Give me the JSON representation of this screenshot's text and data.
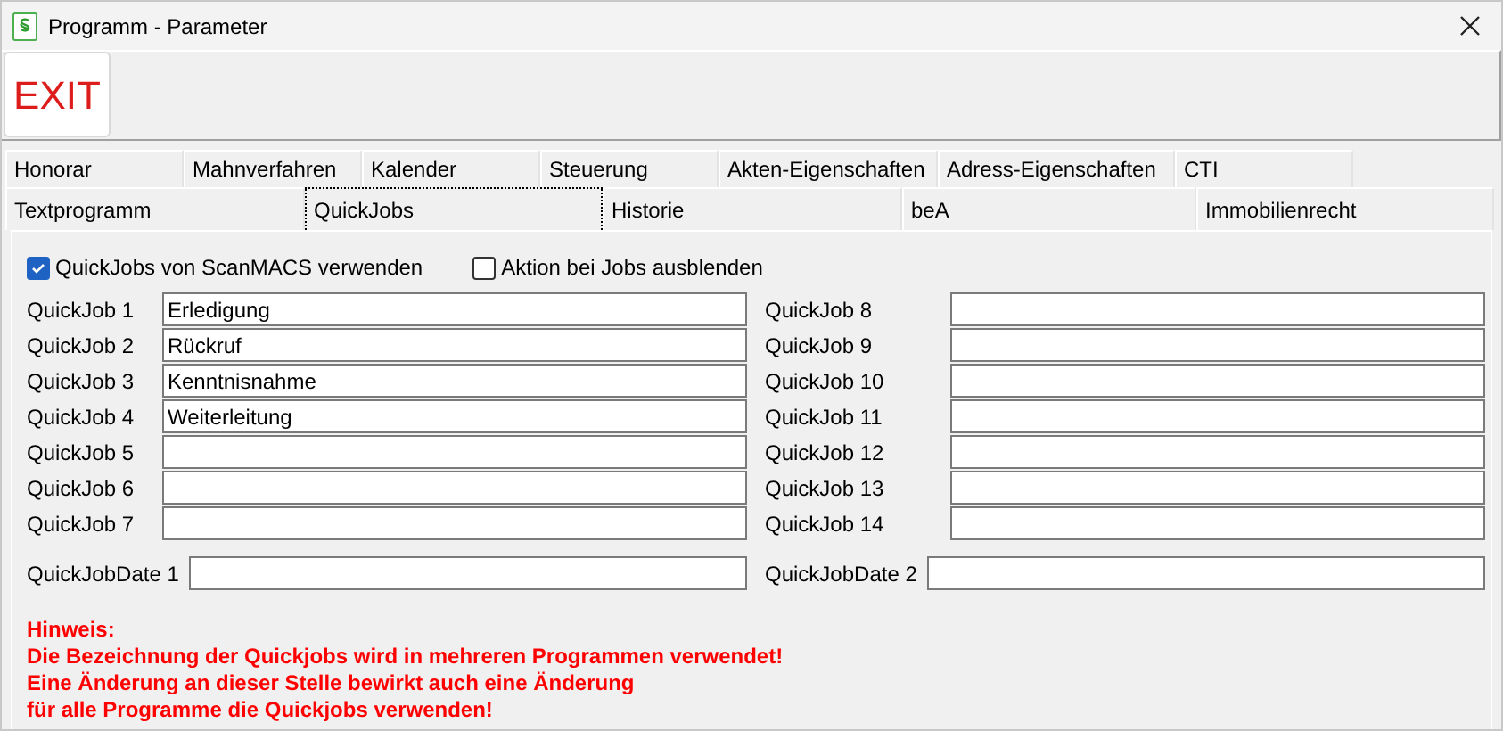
{
  "window": {
    "title": "Programm - Parameter"
  },
  "toolbar": {
    "exit_button": "EXIT"
  },
  "tab_rows": [
    [
      {
        "label": "Honorar",
        "selected": false
      },
      {
        "label": "Mahnverfahren",
        "selected": false
      },
      {
        "label": "Kalender",
        "selected": false
      },
      {
        "label": "Steuerung",
        "selected": false
      },
      {
        "label": "Akten-Eigenschaften",
        "selected": false
      },
      {
        "label": "Adress-Eigenschaften",
        "selected": false
      },
      {
        "label": "CTI",
        "selected": false
      }
    ],
    [
      {
        "label": "Textprogramm",
        "selected": false
      },
      {
        "label": "QuickJobs",
        "selected": true
      },
      {
        "label": "Historie",
        "selected": false
      },
      {
        "label": "beA",
        "selected": false
      },
      {
        "label": "Immobilienrecht",
        "selected": false
      }
    ]
  ],
  "options": [
    {
      "label": "QuickJobs von ScanMACS verwenden",
      "checked": true
    },
    {
      "label": "Aktion bei Jobs ausblenden",
      "checked": false
    }
  ],
  "quickjobs_left": [
    {
      "label": "QuickJob 1",
      "value": "Erledigung"
    },
    {
      "label": "QuickJob 2",
      "value": "Rückruf"
    },
    {
      "label": "QuickJob 3",
      "value": "Kenntnisnahme"
    },
    {
      "label": "QuickJob 4",
      "value": "Weiterleitung"
    },
    {
      "label": "QuickJob 5"
    },
    {
      "label": "QuickJob 6"
    },
    {
      "label": "QuickJob 7"
    }
  ],
  "quickjobs_right": [
    {
      "label": "QuickJob 8"
    },
    {
      "label": "QuickJob 9"
    },
    {
      "label": "QuickJob 10"
    },
    {
      "label": "QuickJob 11"
    },
    {
      "label": "QuickJob 12"
    },
    {
      "label": "QuickJob 13"
    },
    {
      "label": "QuickJob 14"
    }
  ],
  "dates": [
    {
      "label": "QuickJobDate 1"
    },
    {
      "label": "QuickJobDate 2"
    }
  ],
  "notice": [
    "Hinweis:",
    "Die Bezeichnung der Quickjobs wird in mehreren Programmen verwendet!",
    "Eine Änderung an dieser Stelle bewirkt auch eine Änderung",
    "für alle Programme die Quickjobs verwenden!"
  ]
}
